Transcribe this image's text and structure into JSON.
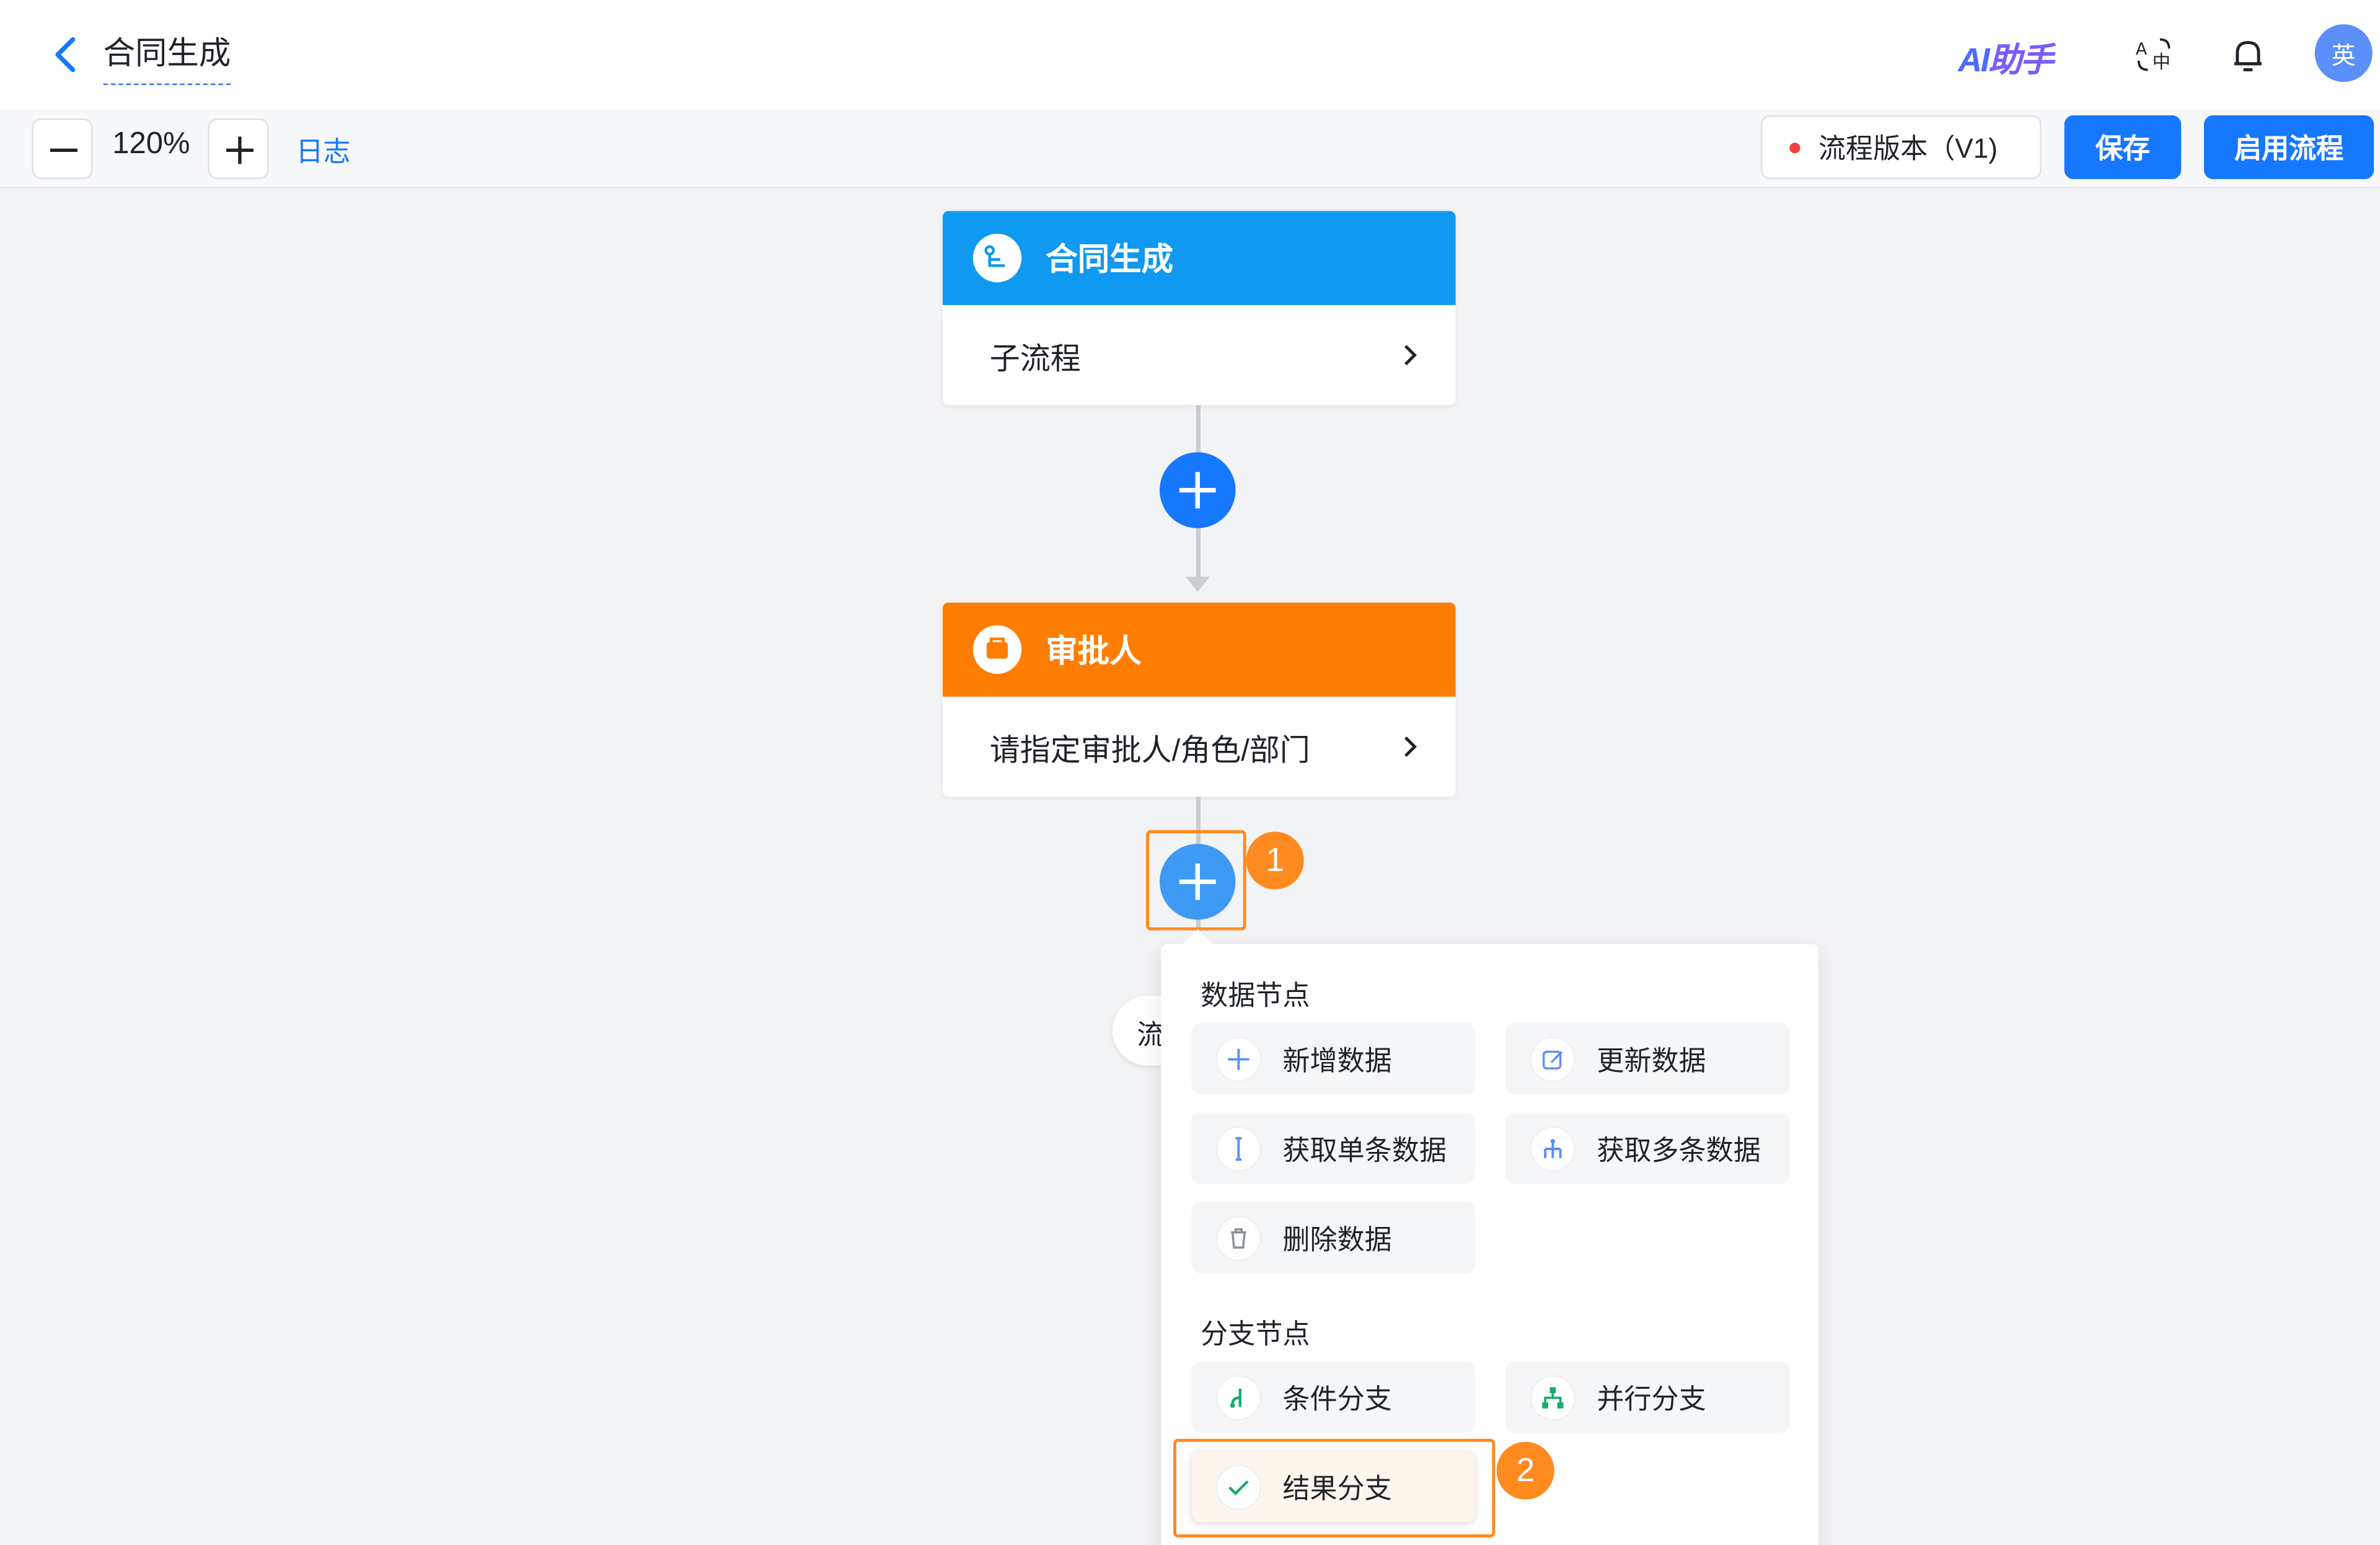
{
  "header": {
    "title": "合同生成",
    "ai_label_a": "AI",
    "ai_label_b": "助手",
    "avatar_text": "英"
  },
  "toolbar": {
    "zoom_value": "120%",
    "log_label": "日志",
    "version_label": "流程版本（V1)",
    "save_label": "保存",
    "enable_label": "启用流程"
  },
  "flow": {
    "nodes": [
      {
        "title": "合同生成",
        "body": "子流程",
        "color": "#0f99f0"
      },
      {
        "title": "审批人",
        "body": "请指定审批人/角色/部门",
        "color": "#ff7d00"
      }
    ],
    "hidden_pill_text": "流"
  },
  "menu": {
    "sections": [
      {
        "title": "数据节点",
        "items": [
          {
            "label": "新增数据",
            "icon": "plus-icon"
          },
          {
            "label": "更新数据",
            "icon": "edit-icon"
          },
          {
            "label": "获取单条数据",
            "icon": "single-data-icon"
          },
          {
            "label": "获取多条数据",
            "icon": "multi-data-icon"
          },
          {
            "label": "删除数据",
            "icon": "trash-icon"
          }
        ]
      },
      {
        "title": "分支节点",
        "items": [
          {
            "label": "条件分支",
            "icon": "condition-branch-icon"
          },
          {
            "label": "并行分支",
            "icon": "parallel-branch-icon"
          },
          {
            "label": "结果分支",
            "icon": "check-icon"
          }
        ]
      }
    ]
  },
  "annotations": {
    "step1": "1",
    "step2": "2"
  },
  "colors": {
    "primary": "#1677ff",
    "highlight": "#ff8a1f",
    "node_blue": "#0f99f0",
    "node_orange": "#ff7d00"
  }
}
